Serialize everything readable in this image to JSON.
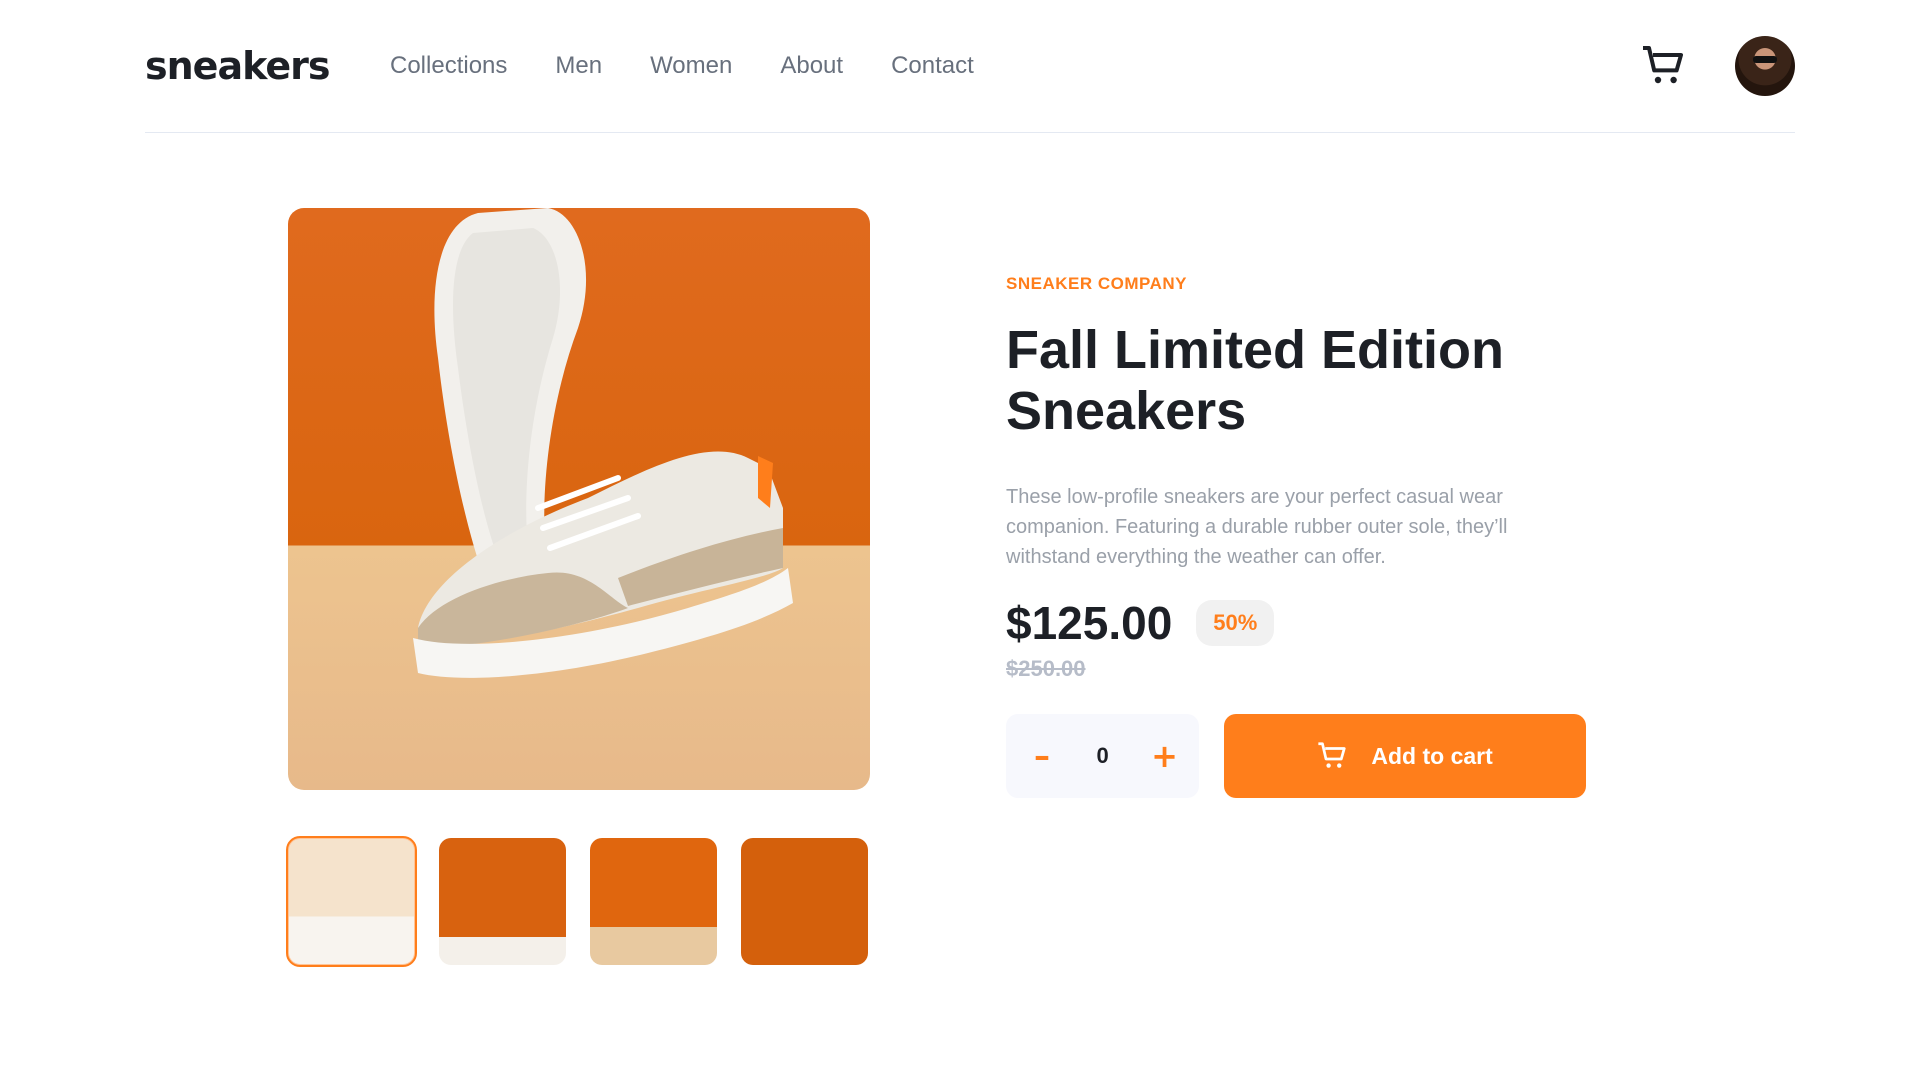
{
  "brand": {
    "logo": "sneakers"
  },
  "nav": {
    "items": [
      {
        "label": "Collections"
      },
      {
        "label": "Men"
      },
      {
        "label": "Women"
      },
      {
        "label": "About"
      },
      {
        "label": "Contact"
      }
    ]
  },
  "header": {
    "cart_icon": "cart-icon",
    "avatar_icon": "user-avatar"
  },
  "gallery": {
    "main_image": "white sneakers on orange background",
    "thumbnails": [
      {
        "name": "thumbnail-1",
        "active": true
      },
      {
        "name": "thumbnail-2",
        "active": false
      },
      {
        "name": "thumbnail-3",
        "active": false
      },
      {
        "name": "thumbnail-4",
        "active": false
      }
    ]
  },
  "product": {
    "company": "SNEAKER COMPANY",
    "title": "Fall Limited Edition Sneakers",
    "description": "These low-profile sneakers are your perfect casual wear companion. Featuring a durable rubber outer sole, they’ll withstand everything the weather can offer.",
    "price": "$125.00",
    "discount": "50%",
    "old_price": "$250.00"
  },
  "cart": {
    "minus_label": "–",
    "plus_label": "+",
    "quantity": "0",
    "add_label": "Add to cart"
  },
  "colors": {
    "accent": "#ff7e1b",
    "text_dark": "#1d2026",
    "text_muted": "#68707d"
  }
}
